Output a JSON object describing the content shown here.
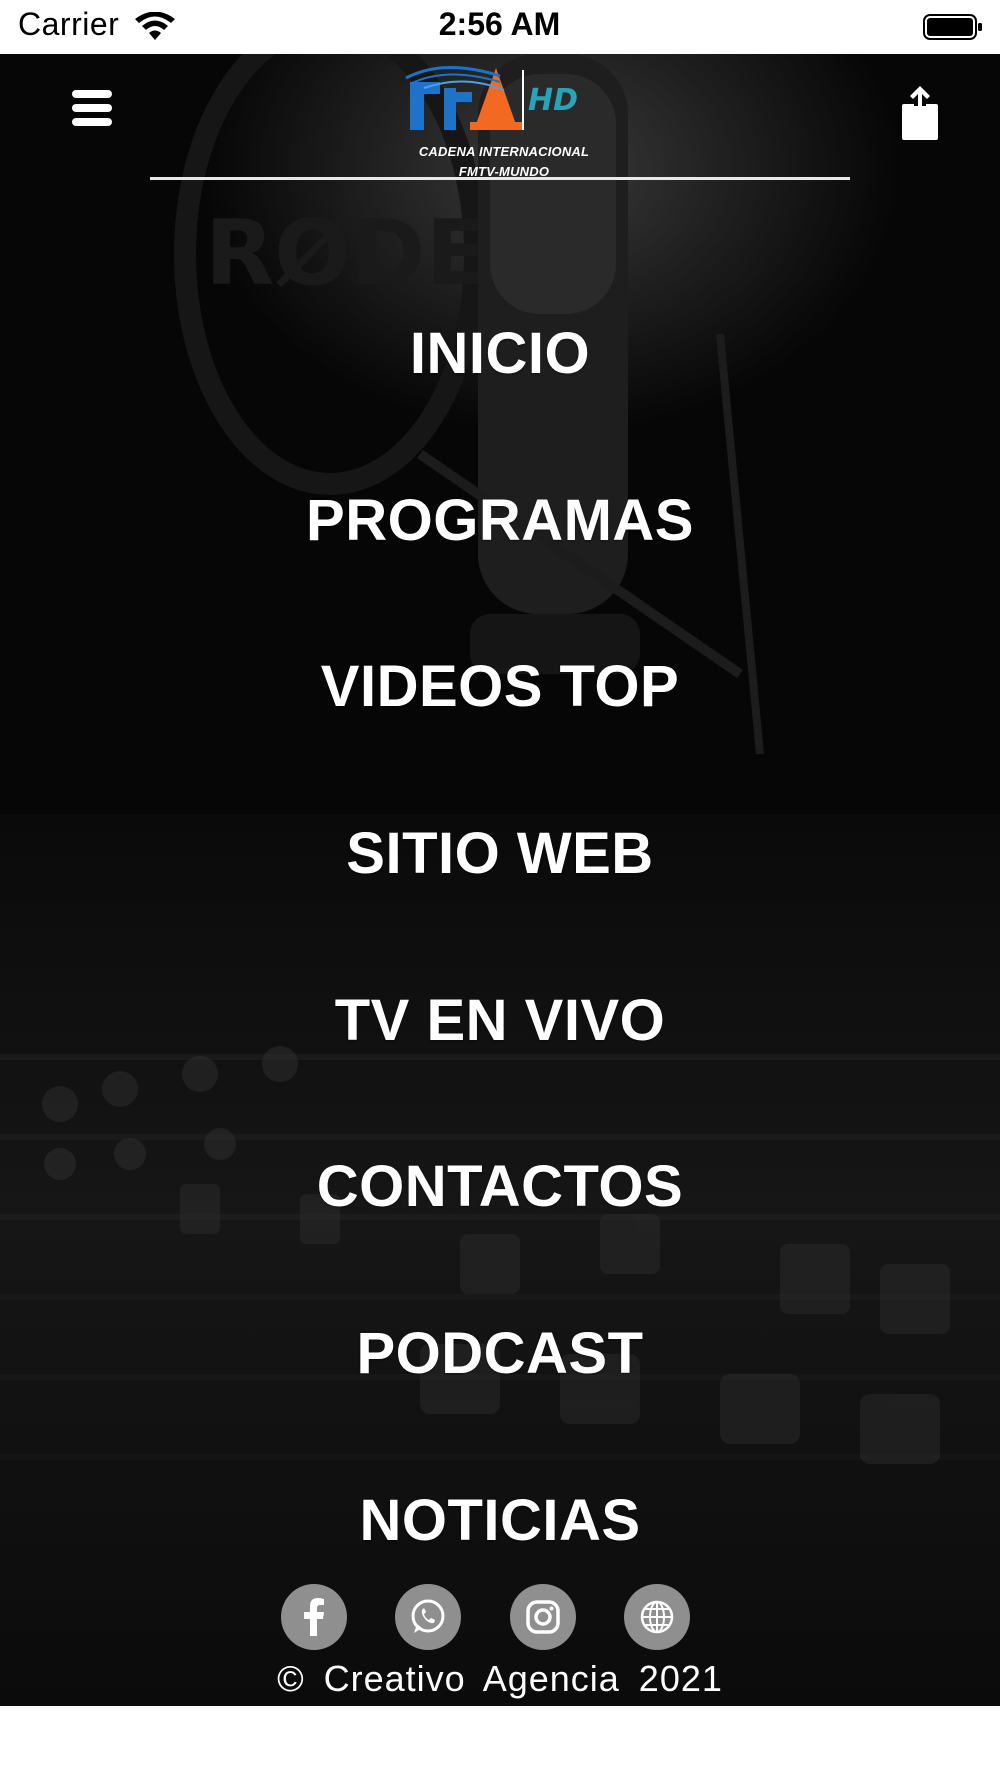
{
  "status_bar": {
    "carrier": "Carrier",
    "time": "2:56 AM",
    "wifi_icon": "wifi-icon",
    "battery_icon": "battery-full-icon"
  },
  "header": {
    "menu_icon": "hamburger-menu-icon",
    "share_icon": "share-icon",
    "logo": {
      "mark": "FM TV HD",
      "hd": "HD",
      "line1": "CADENA INTERNACIONAL",
      "line2": "FMTV-MUNDO",
      "colors": {
        "blue": "#1e73c8",
        "orange": "#f26a21",
        "teal": "#2aa3b8"
      }
    }
  },
  "nav": {
    "items": [
      {
        "label": "INICIO"
      },
      {
        "label": "PROGRAMAS"
      },
      {
        "label": "VIDEOS TOP"
      },
      {
        "label": "SITIO WEB"
      },
      {
        "label": "TV EN VIVO"
      },
      {
        "label": "CONTACTOS"
      },
      {
        "label": "PODCAST"
      },
      {
        "label": "NOTICIAS"
      }
    ]
  },
  "social": [
    {
      "name": "facebook",
      "icon": "facebook-icon"
    },
    {
      "name": "whatsapp",
      "icon": "whatsapp-icon"
    },
    {
      "name": "instagram",
      "icon": "instagram-icon"
    },
    {
      "name": "website",
      "icon": "globe-icon"
    }
  ],
  "footer": {
    "copyright": "© Creativo Agencia 2021"
  },
  "colors": {
    "background": "#070707",
    "text": "#ffffff",
    "social_button": "#8f8f8f"
  }
}
